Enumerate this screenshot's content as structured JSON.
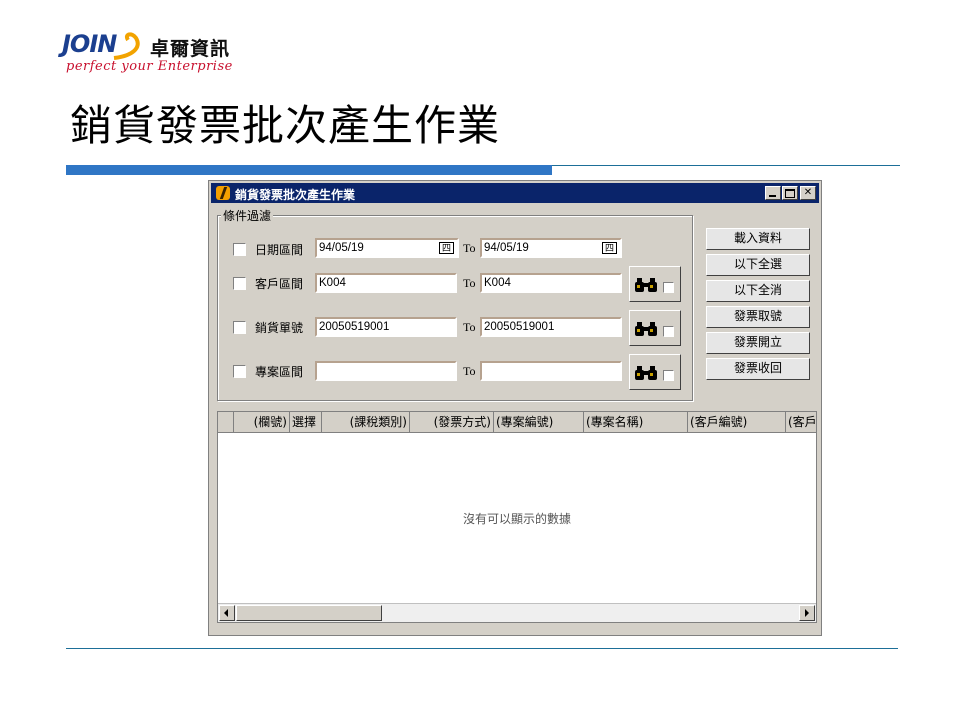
{
  "slide": {
    "logo_main": "JOIN",
    "logo_company": "卓爾資訊",
    "logo_tagline": "perfect your Enterprise",
    "title": "銷貨發票批次產生作業"
  },
  "window": {
    "title": "銷貨發票批次產生作業",
    "filter_group_label": "條件過濾",
    "to_label": "To",
    "rows": [
      {
        "label": "日期區間",
        "from": "94/05/19",
        "to": "94/05/19",
        "has_calendar": true
      },
      {
        "label": "客戶區間",
        "from": "K004",
        "to": "K004",
        "has_lookup": true
      },
      {
        "label": "銷貨單號",
        "from": "20050519001",
        "to": "20050519001",
        "has_lookup": true
      },
      {
        "label": "專案區間",
        "from": "",
        "to": "",
        "has_lookup": true
      }
    ],
    "buttons": [
      "載入資料",
      "以下全選",
      "以下全消",
      "發票取號",
      "發票開立",
      "發票收回"
    ],
    "grid": {
      "columns": [
        "",
        "(欄號)",
        "選擇",
        "(課稅類別)",
        "(發票方式)",
        "(專案編號)",
        "(專案名稱)",
        "(客戶編號)",
        "(客戶"
      ],
      "empty_message": "沒有可以顯示的數據"
    }
  }
}
